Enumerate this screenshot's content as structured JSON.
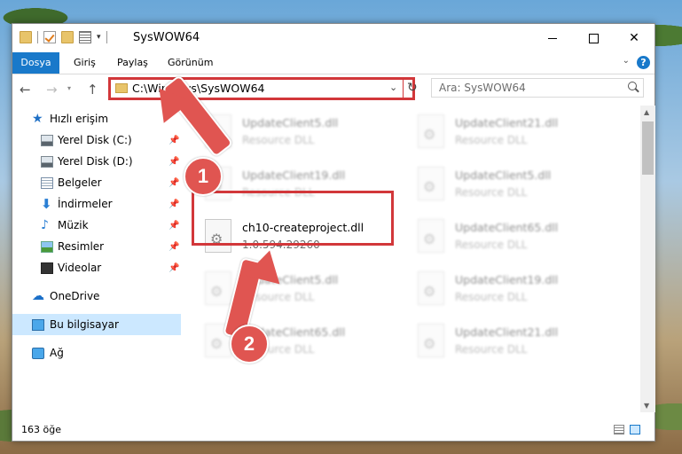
{
  "window": {
    "title": "SysWOW64",
    "ribbon_tabs": [
      "Dosya",
      "Giriş",
      "Paylaş",
      "Görünüm"
    ],
    "help_glyph": "?"
  },
  "navigation": {
    "address": "C:\\Windows\\SysWOW64",
    "search_placeholder": "Ara: SysWOW64"
  },
  "sidebar": {
    "items": [
      {
        "label": "Hızlı erişim",
        "icon": "star-icon"
      },
      {
        "label": "Yerel Disk (C:)",
        "icon": "drive-icon"
      },
      {
        "label": "Yerel Disk (D:)",
        "icon": "drive-icon"
      },
      {
        "label": "Belgeler",
        "icon": "documents-icon"
      },
      {
        "label": "İndirmeler",
        "icon": "downloads-icon"
      },
      {
        "label": "Müzik",
        "icon": "music-icon"
      },
      {
        "label": "Resimler",
        "icon": "pictures-icon"
      },
      {
        "label": "Videolar",
        "icon": "videos-icon"
      },
      {
        "label": "OneDrive",
        "icon": "onedrive-icon"
      },
      {
        "label": "Bu bilgisayar",
        "icon": "computer-icon"
      },
      {
        "label": "Ağ",
        "icon": "network-icon"
      }
    ]
  },
  "files": [
    {
      "name": "UpdateClient5.dll",
      "desc": "Resource DLL"
    },
    {
      "name": "UpdateClient21.dll",
      "desc": "Resource DLL"
    },
    {
      "name": "UpdateClient19.dll",
      "desc": "Resource DLL"
    },
    {
      "name": "UpdateClient5.dll",
      "desc": "Resource DLL"
    },
    {
      "name": "ch10-createproject.dll",
      "desc": "1.0.594.29260"
    },
    {
      "name": "UpdateClient65.dll",
      "desc": "Resource DLL"
    },
    {
      "name": "UpdateClient5.dll",
      "desc": "Resource DLL"
    },
    {
      "name": "UpdateClient19.dll",
      "desc": "Resource DLL"
    },
    {
      "name": "UpdateClient65.dll",
      "desc": "Resource DLL"
    },
    {
      "name": "UpdateClient21.dll",
      "desc": "Resource DLL"
    }
  ],
  "status": {
    "count": "163 öğe"
  },
  "annotations": {
    "step1": "1",
    "step2": "2",
    "color": "#e05551",
    "highlight_color": "#d2373a"
  },
  "colors": {
    "accent": "#1979ca",
    "selection": "#cce8ff"
  }
}
